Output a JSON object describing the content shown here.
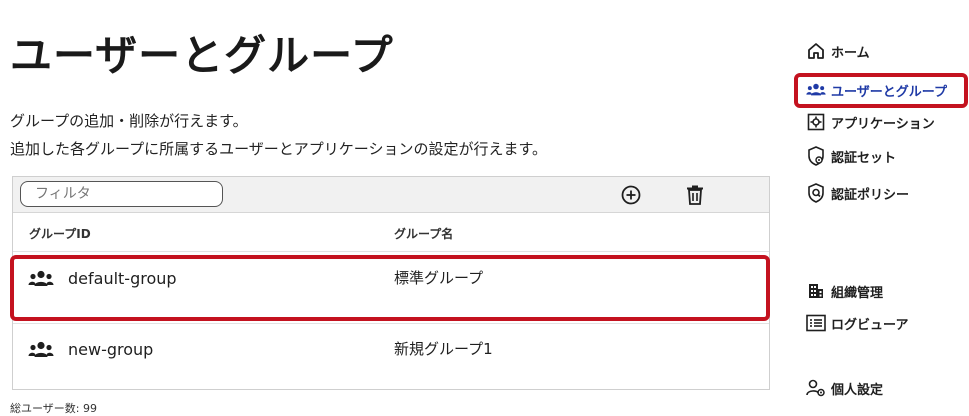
{
  "page": {
    "title": "ユーザーとグループ",
    "description_line1": "グループの追加・削除が行えます。",
    "description_line2": "追加した各グループに所属するユーザーとアプリケーションの設定が行えます。"
  },
  "toolbar": {
    "filter_placeholder": "フィルタ",
    "add_icon": "plus-circle-icon",
    "delete_icon": "trash-icon"
  },
  "table": {
    "columns": [
      "グループID",
      "グループ名"
    ],
    "rows": [
      {
        "id": "default-group",
        "name": "標準グループ",
        "icon": "group-icon"
      },
      {
        "id": "new-group",
        "name": "新規グループ1",
        "icon": "group-icon"
      }
    ]
  },
  "footer": {
    "total_users": "総ユーザー数: 99"
  },
  "sidebar": {
    "items": [
      {
        "label": "ホーム",
        "icon": "home-icon"
      },
      {
        "label": "ユーザーとグループ",
        "icon": "users-icon",
        "active": true
      },
      {
        "label": "アプリケーション",
        "icon": "app-gear-icon"
      },
      {
        "label": "認証セット",
        "icon": "shield-gear-icon"
      },
      {
        "label": "認証ポリシー",
        "icon": "shield-lock-icon"
      },
      {
        "label": "組織管理",
        "icon": "building-icon"
      },
      {
        "label": "ログビューア",
        "icon": "log-list-icon"
      },
      {
        "label": "個人設定",
        "icon": "user-gear-icon"
      }
    ]
  },
  "colors": {
    "highlight": "#c4121f",
    "active_nav": "#1f3aa6"
  }
}
